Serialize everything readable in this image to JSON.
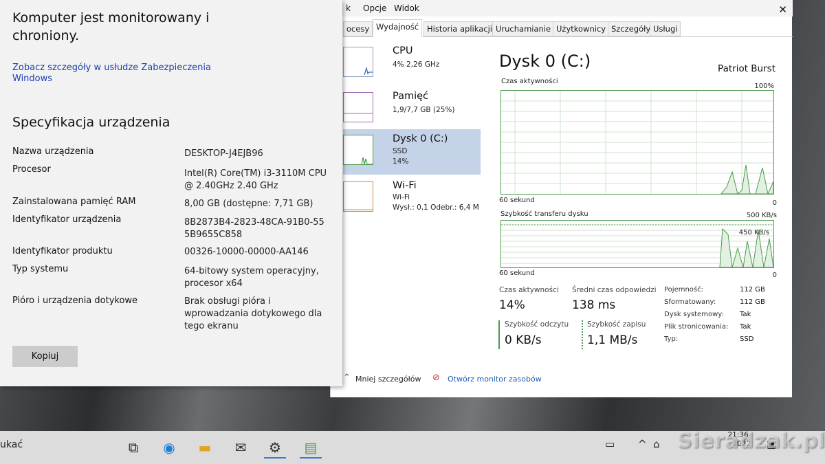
{
  "task_manager": {
    "menu": [
      {
        "label": "k"
      },
      {
        "label": "Opcje"
      },
      {
        "label": "Widok"
      }
    ],
    "tabs": [
      {
        "label": "ocesy"
      },
      {
        "label": "Wydajność",
        "active": true
      },
      {
        "label": "Historia aplikacji"
      },
      {
        "label": "Uruchamianie"
      },
      {
        "label": "Użytkownicy"
      },
      {
        "label": "Szczegóły"
      },
      {
        "label": "Usługi"
      }
    ],
    "resources": [
      {
        "title": "CPU",
        "lines": [
          "4% 2,26 GHz"
        ]
      },
      {
        "title": "Pamięć",
        "lines": [
          "1,9/7,7 GB (25%)"
        ]
      },
      {
        "title": "Dysk 0 (C:)",
        "lines": [
          "SSD",
          "14%"
        ],
        "selected": true
      },
      {
        "title": "Wi-Fi",
        "lines": [
          "Wi-Fi",
          "Wysł.: 0,1 Odebr.: 6,4 M"
        ]
      }
    ],
    "detail": {
      "title": "Dysk 0 (C:)",
      "model": "Patriot Burst",
      "activity_label": "Czas aktywności",
      "activity_max": "100%",
      "activity_time": "60 sekund",
      "activity_min": "0",
      "transfer_label": "Szybkość transferu dysku",
      "transfer_max": "500 KB/s",
      "transfer_mid": "450 KB/s",
      "transfer_time": "60 sekund",
      "transfer_min": "0",
      "stats": {
        "active_time_label": "Czas aktywności",
        "active_time_value": "14%",
        "avg_response_label": "Średni czas odpowiedzi",
        "avg_response_value": "138 ms",
        "read_label": "Szybkość odczytu",
        "read_value": "0 KB/s",
        "write_label": "Szybkość zapisu",
        "write_value": "1,1 MB/s"
      },
      "properties": [
        {
          "key": "Pojemność:",
          "value": "112 GB"
        },
        {
          "key": "Sformatowany:",
          "value": "112 GB"
        },
        {
          "key": "Dysk systemowy:",
          "value": "Tak"
        },
        {
          "key": "Plik stronicowania:",
          "value": "Tak"
        },
        {
          "key": "Typ:",
          "value": "SSD"
        }
      ]
    },
    "footer": {
      "less_details": "Mniej szczegółów",
      "open_monitor": "Otwórz monitor zasobów"
    }
  },
  "about": {
    "heading": "Komputer jest monitorowany i chroniony.",
    "security_link": "Zobacz szczegóły w usłudze Zabezpieczenia Windows",
    "spec_heading": "Specyfikacja urządzenia",
    "specs": [
      {
        "key": "Nazwa urządzenia",
        "value": "DESKTOP-J4EJB96"
      },
      {
        "key": "Procesor",
        "value": "Intel(R) Core(TM) i3-3110M CPU @ 2.40GHz   2.40 GHz"
      },
      {
        "key": "Zainstalowana pamięć RAM",
        "value": "8,00 GB (dostępne: 7,71 GB)"
      },
      {
        "key": "Identyfikator urządzenia",
        "value": "8B2873B4-2823-48CA-91B0-55 5B9655C858"
      },
      {
        "key": "Identyfikator produktu",
        "value": "00326-10000-00000-AA146"
      },
      {
        "key": "Typ systemu",
        "value": "64-bitowy system operacyjny, procesor x64"
      },
      {
        "key": "Pióro i urządzenia dotykowe",
        "value": "Brak obsługi pióra i wprowadzania dotykowego dla tego ekranu"
      }
    ],
    "copy_button": "Kopiuj"
  },
  "taskbar": {
    "search_text": "ukać",
    "clock_time": "21:36",
    "clock_date": "…2022",
    "icons": [
      "task-view-icon",
      "edge-icon",
      "file-explorer-icon",
      "mail-icon",
      "settings-icon",
      "task-manager-icon"
    ]
  },
  "watermark": "Sieradzak.pl",
  "colors": {
    "graph_green": "#4c9a4c",
    "selected_bg": "#c5d3e8",
    "link_blue": "#1c3fae"
  }
}
